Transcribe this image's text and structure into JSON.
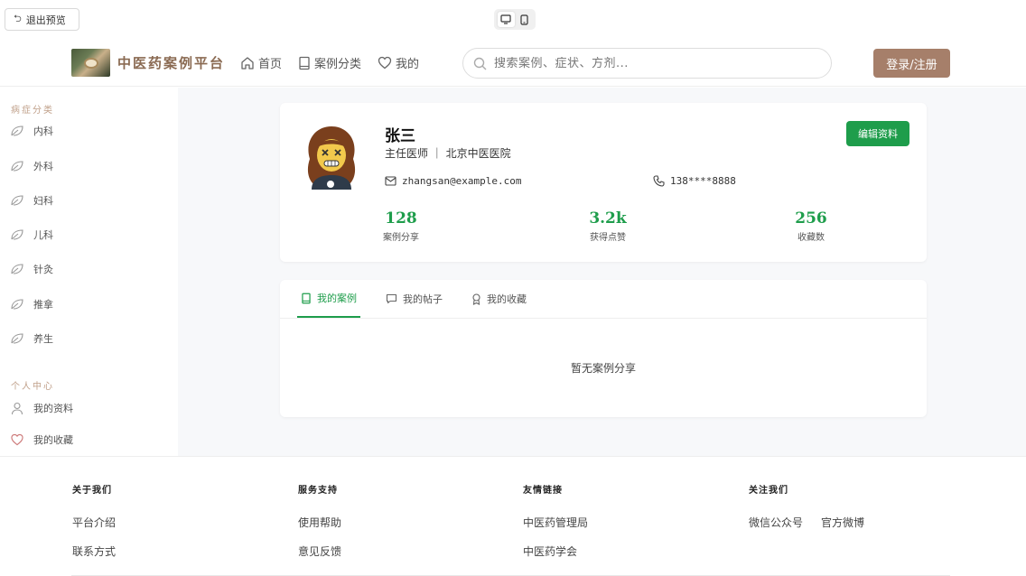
{
  "preview": {
    "exit_label": "退出预览",
    "devices": [
      "desktop-icon",
      "mobile-icon"
    ]
  },
  "header": {
    "logo_text": "中医药案例平台",
    "nav": [
      {
        "label": "首页",
        "icon": "home-icon"
      },
      {
        "label": "案例分类",
        "icon": "book-icon"
      },
      {
        "label": "我的",
        "icon": "heart-icon"
      }
    ],
    "search_placeholder": "搜索案例、症状、方剂...",
    "login_label": "登录/注册"
  },
  "sidebar": {
    "section1_title": "病症分类",
    "categories": [
      "内科",
      "外科",
      "妇科",
      "儿科",
      "针灸",
      "推拿",
      "养生"
    ],
    "section2_title": "个人中心",
    "personal": [
      {
        "label": "我的资料",
        "icon": "user-icon"
      },
      {
        "label": "我的收藏",
        "icon": "heart-icon"
      }
    ]
  },
  "profile": {
    "name": "张三",
    "role": "主任医师 ｜ 北京中医医院",
    "edit_label": "编辑资料",
    "email": "zhangsan@example.com",
    "phone": "138****8888",
    "stats": [
      {
        "value": "128",
        "label": "案例分享"
      },
      {
        "value": "3.2k",
        "label": "获得点赞"
      },
      {
        "value": "256",
        "label": "收藏数"
      }
    ]
  },
  "tabs": {
    "items": [
      {
        "label": "我的案例",
        "icon": "book-icon",
        "active": true
      },
      {
        "label": "我的帖子",
        "icon": "chat-icon",
        "active": false
      },
      {
        "label": "我的收藏",
        "icon": "award-icon",
        "active": false
      }
    ],
    "empty_text": "暂无案例分享"
  },
  "footer": {
    "columns": [
      {
        "title": "关于我们",
        "links": [
          "平台介绍",
          "联系方式"
        ]
      },
      {
        "title": "服务支持",
        "links": [
          "使用帮助",
          "意见反馈"
        ]
      },
      {
        "title": "友情链接",
        "links": [
          "中医药管理局",
          "中医药学会"
        ]
      },
      {
        "title": "关注我们",
        "links": [
          "微信公众号",
          "官方微博"
        ]
      }
    ]
  },
  "colors": {
    "accent_green": "#1e9d4b",
    "brand_brown": "#a67f6a",
    "logo_text": "#8a6a52"
  }
}
